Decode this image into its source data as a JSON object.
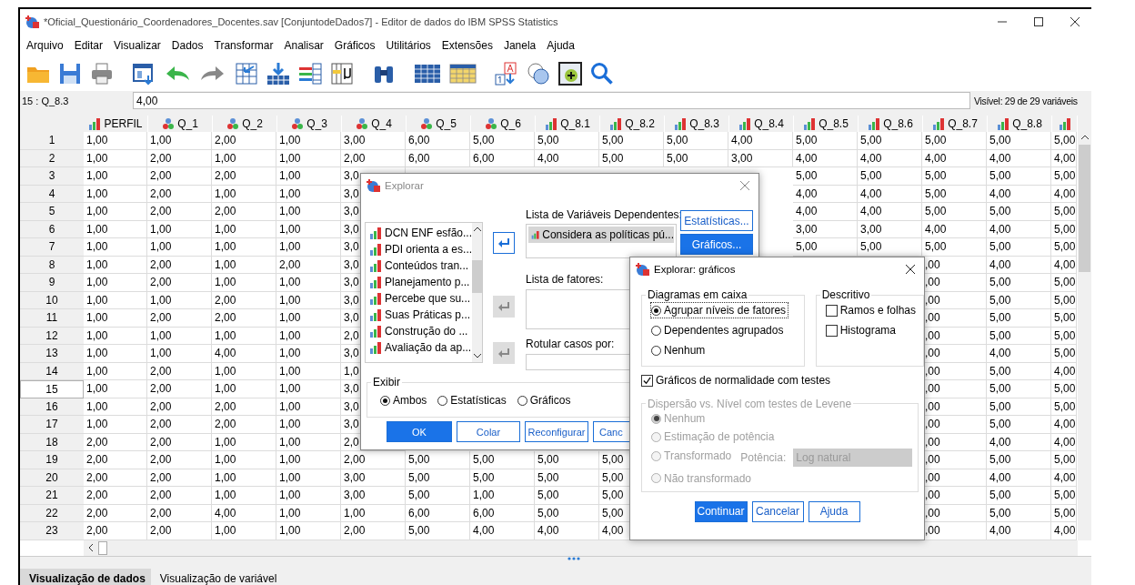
{
  "window": {
    "title": "*Oficial_Questionário_Coordenadores_Docentes.sav [ConjuntodeDados7] - Editor de dados do IBM SPSS Statistics"
  },
  "menu": [
    "Arquivo",
    "Editar",
    "Visualizar",
    "Dados",
    "Transformar",
    "Analisar",
    "Gráficos",
    "Utilitários",
    "Extensões",
    "Janela",
    "Ajuda"
  ],
  "cell_editor": {
    "cell": "15 : Q_8.3",
    "value": "4,00",
    "visible": "Visível: 29 de 29 variáveis"
  },
  "grid": {
    "columns": [
      {
        "label": "PERFIL",
        "kind": "ordinal"
      },
      {
        "label": "Q_1",
        "kind": "nominal"
      },
      {
        "label": "Q_2",
        "kind": "nominal"
      },
      {
        "label": "Q_3",
        "kind": "nominal"
      },
      {
        "label": "Q_4",
        "kind": "nominal"
      },
      {
        "label": "Q_5",
        "kind": "nominal"
      },
      {
        "label": "Q_6",
        "kind": "nominal"
      },
      {
        "label": "Q_8.1",
        "kind": "ordinal"
      },
      {
        "label": "Q_8.2",
        "kind": "ordinal"
      },
      {
        "label": "Q_8.3",
        "kind": "ordinal"
      },
      {
        "label": "Q_8.4",
        "kind": "ordinal"
      },
      {
        "label": "Q_8.5",
        "kind": "ordinal"
      },
      {
        "label": "Q_8.6",
        "kind": "ordinal"
      },
      {
        "label": "Q_8.7",
        "kind": "ordinal"
      },
      {
        "label": "Q_8.8",
        "kind": "ordinal"
      },
      {
        "kind": "ordinal"
      }
    ],
    "rows": [
      {
        "label": "1",
        "selected": false,
        "cells": [
          "1,00",
          "1,00",
          "2,00",
          "1,00",
          "3,00",
          "6,00",
          "5,00",
          "5,00",
          "5,00",
          "5,00",
          "4,00",
          "5,00",
          "5,00",
          "5,00",
          "5,00",
          "5,00"
        ]
      },
      {
        "label": "2",
        "selected": false,
        "cells": [
          "1,00",
          "2,00",
          "1,00",
          "1,00",
          "2,00",
          "6,00",
          "6,00",
          "4,00",
          "5,00",
          "5,00",
          "3,00",
          "4,00",
          "4,00",
          "4,00",
          "4,00",
          "4,00"
        ]
      },
      {
        "label": "3",
        "selected": false,
        "cells": [
          "1,00",
          "2,00",
          "2,00",
          "1,00",
          "3,0",
          null,
          null,
          null,
          null,
          null,
          null,
          "5,00",
          "5,00",
          "5,00",
          "5,00",
          "5,00"
        ]
      },
      {
        "label": "4",
        "selected": false,
        "cells": [
          "1,00",
          "2,00",
          "1,00",
          "1,00",
          "3,0",
          null,
          null,
          null,
          null,
          null,
          null,
          "4,00",
          "4,00",
          "5,00",
          "4,00",
          "4,00"
        ]
      },
      {
        "label": "5",
        "selected": false,
        "cells": [
          "1,00",
          "2,00",
          "2,00",
          "1,00",
          "3,0",
          null,
          null,
          null,
          null,
          null,
          null,
          "4,00",
          "4,00",
          "5,00",
          "5,00",
          "5,00"
        ]
      },
      {
        "label": "6",
        "selected": false,
        "cells": [
          "1,00",
          "1,00",
          "1,00",
          "1,00",
          "3,0",
          null,
          null,
          null,
          null,
          null,
          null,
          "3,00",
          "3,00",
          "4,00",
          "4,00",
          "5,00"
        ]
      },
      {
        "label": "7",
        "selected": false,
        "cells": [
          "1,00",
          "1,00",
          "1,00",
          "1,00",
          "3,0",
          null,
          null,
          null,
          null,
          null,
          null,
          "5,00",
          "5,00",
          "5,00",
          "5,00",
          "5,00"
        ]
      },
      {
        "label": "8",
        "selected": false,
        "cells": [
          "1,00",
          "2,00",
          "1,00",
          "2,00",
          "3,0",
          null,
          null,
          null,
          null,
          null,
          null,
          null,
          null,
          ",00",
          "4,00",
          "4,00"
        ]
      },
      {
        "label": "9",
        "selected": false,
        "cells": [
          "1,00",
          "2,00",
          "1,00",
          "1,00",
          "3,0",
          null,
          null,
          null,
          null,
          null,
          null,
          null,
          null,
          ",00",
          "5,00",
          "5,00"
        ]
      },
      {
        "label": "10",
        "selected": false,
        "cells": [
          "1,00",
          "1,00",
          "2,00",
          "1,00",
          "3,0",
          null,
          null,
          null,
          null,
          null,
          null,
          null,
          null,
          ",00",
          "5,00",
          "5,00"
        ]
      },
      {
        "label": "11",
        "selected": false,
        "cells": [
          "1,00",
          "2,00",
          "2,00",
          "1,00",
          "3,0",
          null,
          null,
          null,
          null,
          null,
          null,
          null,
          null,
          ",00",
          "5,00",
          "5,00"
        ]
      },
      {
        "label": "12",
        "selected": false,
        "cells": [
          "1,00",
          "1,00",
          "1,00",
          "1,00",
          "2,0",
          null,
          null,
          null,
          null,
          null,
          null,
          null,
          null,
          ",00",
          "5,00",
          "5,00"
        ]
      },
      {
        "label": "13",
        "selected": false,
        "cells": [
          "1,00",
          "1,00",
          "4,00",
          "1,00",
          "3,0",
          null,
          null,
          null,
          null,
          null,
          null,
          null,
          null,
          ",00",
          "4,00",
          "5,00"
        ]
      },
      {
        "label": "14",
        "selected": false,
        "cells": [
          "1,00",
          "2,00",
          "1,00",
          "1,00",
          "1,0",
          null,
          null,
          null,
          null,
          null,
          null,
          null,
          null,
          ",00",
          "5,00",
          "4,00"
        ]
      },
      {
        "label": "15",
        "selected": true,
        "cells": [
          "1,00",
          "2,00",
          "1,00",
          "1,00",
          "3,0",
          null,
          null,
          null,
          null,
          null,
          null,
          null,
          null,
          ",00",
          "5,00",
          "5,00"
        ]
      },
      {
        "label": "16",
        "selected": false,
        "cells": [
          "1,00",
          "2,00",
          "2,00",
          "1,00",
          "3,0",
          null,
          null,
          null,
          null,
          null,
          null,
          null,
          null,
          ",00",
          "5,00",
          "5,00"
        ]
      },
      {
        "label": "17",
        "selected": false,
        "cells": [
          "1,00",
          "2,00",
          "2,00",
          "1,00",
          "3,0",
          null,
          null,
          null,
          null,
          null,
          null,
          null,
          null,
          ",00",
          "5,00",
          "4,00"
        ]
      },
      {
        "label": "18",
        "selected": false,
        "cells": [
          "2,00",
          "2,00",
          "1,00",
          "1,00",
          "2,0",
          null,
          null,
          null,
          null,
          null,
          null,
          null,
          null,
          ",00",
          "4,00",
          "4,00"
        ]
      },
      {
        "label": "19",
        "selected": false,
        "cells": [
          "2,00",
          "2,00",
          "1,00",
          "1,00",
          "2,00",
          "5,00",
          "5,00",
          "5,00",
          "5,00",
          null,
          null,
          null,
          null,
          ",00",
          "5,00",
          "5,00"
        ]
      },
      {
        "label": "20",
        "selected": false,
        "cells": [
          "2,00",
          "2,00",
          "1,00",
          "1,00",
          "3,00",
          "5,00",
          "5,00",
          "5,00",
          "5,00",
          null,
          null,
          null,
          null,
          ",00",
          "4,00",
          "4,00"
        ]
      },
      {
        "label": "21",
        "selected": false,
        "cells": [
          "2,00",
          "2,00",
          "1,00",
          "1,00",
          "3,00",
          "5,00",
          "1,00",
          "5,00",
          "5,00",
          null,
          null,
          null,
          null,
          ",00",
          "5,00",
          "5,00"
        ]
      },
      {
        "label": "22",
        "selected": false,
        "cells": [
          "2,00",
          "2,00",
          "4,00",
          "1,00",
          "1,00",
          "6,00",
          "6,00",
          "5,00",
          "5,00",
          null,
          null,
          null,
          null,
          ",00",
          "5,00",
          "5,00"
        ]
      },
      {
        "label": "23",
        "selected": false,
        "cells": [
          "2,00",
          "2,00",
          "1,00",
          "1,00",
          "2,00",
          "5,00",
          "4,00",
          "4,00",
          "4,00",
          null,
          null,
          null,
          null,
          ",00",
          "4,00",
          "4,00"
        ]
      }
    ]
  },
  "explore_dialog": {
    "title": "Explorar",
    "variables": [
      "DCN ENF esfão...",
      "PDI orienta a es...",
      "Conteúdos tran...",
      "Planejamento p...",
      "Percebe que su...",
      "Suas Práticas p...",
      "Construção do ...",
      "Avaliação da ap..."
    ],
    "move_buttons": [
      {
        "disabled": false
      },
      {
        "disabled": true
      },
      {
        "disabled": true
      }
    ],
    "dependent_label": "Lista de Variáveis Dependentes:",
    "dependents": [
      {
        "label": "Considera as políticas pú...",
        "selected": true
      }
    ],
    "factor_label": "Lista de fatores:",
    "label_cases_label": "Rotular casos por:",
    "side_buttons": [
      {
        "label": "Estatísticas...",
        "kind": "outline"
      },
      {
        "label": "Gráficos...",
        "kind": "primary"
      }
    ],
    "display": {
      "legend": "Exibir",
      "options": [
        {
          "label": "Ambos",
          "selected": true
        },
        {
          "label": "Estatísticas",
          "selected": false
        },
        {
          "label": "Gráficos",
          "selected": false
        }
      ]
    },
    "buttons": [
      {
        "label": "OK",
        "kind": "primary"
      },
      {
        "label": "Colar",
        "kind": "outline"
      },
      {
        "label": "Reconfigurar",
        "kind": "outline"
      },
      {
        "label": "Canc",
        "kind": "outline"
      }
    ]
  },
  "plots_dialog": {
    "title": "Explorar: gráficos",
    "boxplots": {
      "legend": "Diagramas em caixa",
      "options": [
        {
          "label": "Agrupar níveis de fatores",
          "selected": true
        },
        {
          "label": "Dependentes agrupados",
          "selected": false
        },
        {
          "label": "Nenhum",
          "selected": false
        }
      ]
    },
    "descriptive": {
      "legend": "Descritivo",
      "options": [
        {
          "label": "Ramos e folhas",
          "checked": false
        },
        {
          "label": "Histograma",
          "checked": false
        }
      ]
    },
    "normality": {
      "label": "Gráficos de normalidade com testes",
      "checked": true
    },
    "spread": {
      "legend": "Dispersão vs. Nível com testes de Levene",
      "disabled": true,
      "options": [
        {
          "label": "Nenhum",
          "selected": true
        },
        {
          "label": "Estimação de potência",
          "selected": false
        },
        {
          "label": "Transformado",
          "selected": false
        },
        {
          "label": "Não transformado",
          "selected": false
        }
      ],
      "power_label": "Potência:",
      "power_value": "Log natural"
    },
    "buttons": [
      {
        "label": "Continuar",
        "kind": "primary"
      },
      {
        "label": "Cancelar",
        "kind": "outline"
      },
      {
        "label": "Ajuda",
        "kind": "outline"
      }
    ]
  },
  "view_tabs": [
    {
      "label": "Visualização de dados",
      "selected": true
    },
    {
      "label": "Visualização de variável",
      "selected": false
    }
  ]
}
